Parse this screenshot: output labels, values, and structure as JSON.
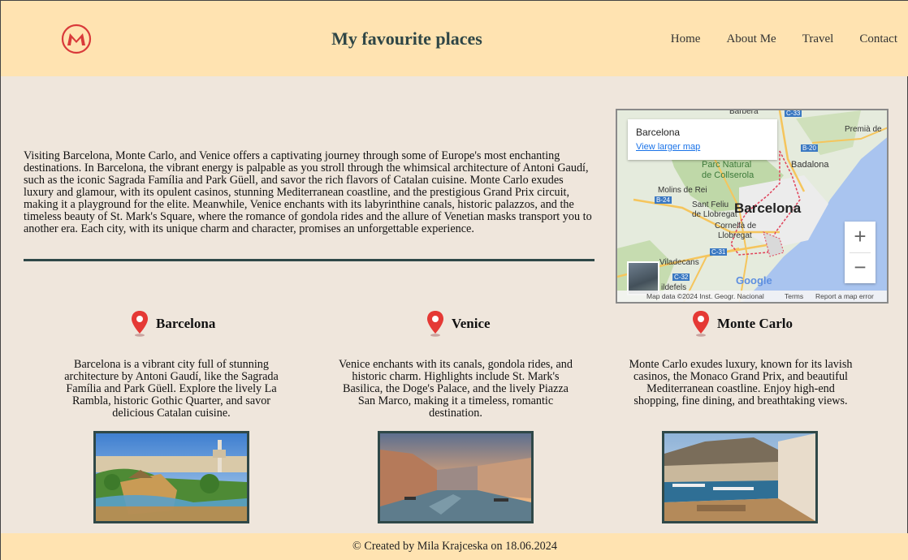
{
  "header": {
    "title": "My favourite places",
    "logo_icon": "mk-logo-icon",
    "nav": [
      "Home",
      "About Me",
      "Travel",
      "Contact"
    ]
  },
  "intro": {
    "text": "Visiting Barcelona, Monte Carlo, and Venice offers a captivating journey through some of Europe's most enchanting destinations. In Barcelona, the vibrant energy is palpable as you stroll through the whimsical architecture of Antoni Gaudí, such as the iconic Sagrada Família and Park Güell, and savor the rich flavors of Catalan cuisine. Monte Carlo exudes luxury and glamour, with its opulent casinos, stunning Mediterranean coastline, and the prestigious Grand Prix circuit, making it a playground for the elite. Meanwhile, Venice enchants with its labyrinthine canals, historic palazzos, and the timeless beauty of St. Mark's Square, where the romance of gondola rides and the allure of Venetian masks transport you to another era. Each city, with its unique charm and character, promises an unforgettable experience."
  },
  "map": {
    "place_title": "Barcelona",
    "larger_map_link": "View larger map",
    "zoom_in": "+",
    "zoom_out": "−",
    "brand": "Google",
    "attribution": "Map data ©2024 Inst. Geogr. Nacional",
    "terms": "Terms",
    "report": "Report a map error",
    "labels": {
      "barbera": "Barbera",
      "premia": "Premià de",
      "badalona": "Badalona",
      "parc": "Parc Natural",
      "collserola": "de Collserola",
      "molins": "Molins de Rei",
      "sant_feliu": "Sant Feliu",
      "llobregat1": "de Llobregat",
      "barcelona": "Barcelona",
      "cornella": "Cornellà de",
      "llobregat2": "Llobregat",
      "viladecans": "Viladecans",
      "castelldefels": "ildefels",
      "road_c33": "C-33",
      "road_b20": "B-20",
      "road_b24": "B-24",
      "road_c31": "C-31",
      "road_c32": "C-32"
    }
  },
  "cities": [
    {
      "name": "Barcelona",
      "description": "Barcelona is a vibrant city full of stunning architecture by Antoni Gaudí, like the Sagrada Família and Park Güell. Explore the lively La Rambla, historic Gothic Quarter, and savor delicious Catalan cuisine."
    },
    {
      "name": "Venice",
      "description": "Venice enchants with its canals, gondola rides, and historic charm. Highlights include St. Mark's Basilica, the Doge's Palace, and the lively Piazza San Marco, making it a timeless, romantic destination."
    },
    {
      "name": "Monte Carlo",
      "description": "Monte Carlo exudes luxury, known for its lavish casinos, the Monaco Grand Prix, and beautiful Mediterranean coastline. Enjoy high-end shopping, fine dining, and breathtaking views."
    }
  ],
  "footer": {
    "text": "© Created by Mila Krajceska on 18.06.2024"
  },
  "colors": {
    "header_bg": "#ffe3b1",
    "page_bg": "#efe6dc",
    "accent_dark": "#2f4848",
    "pin_red": "#e53935"
  }
}
